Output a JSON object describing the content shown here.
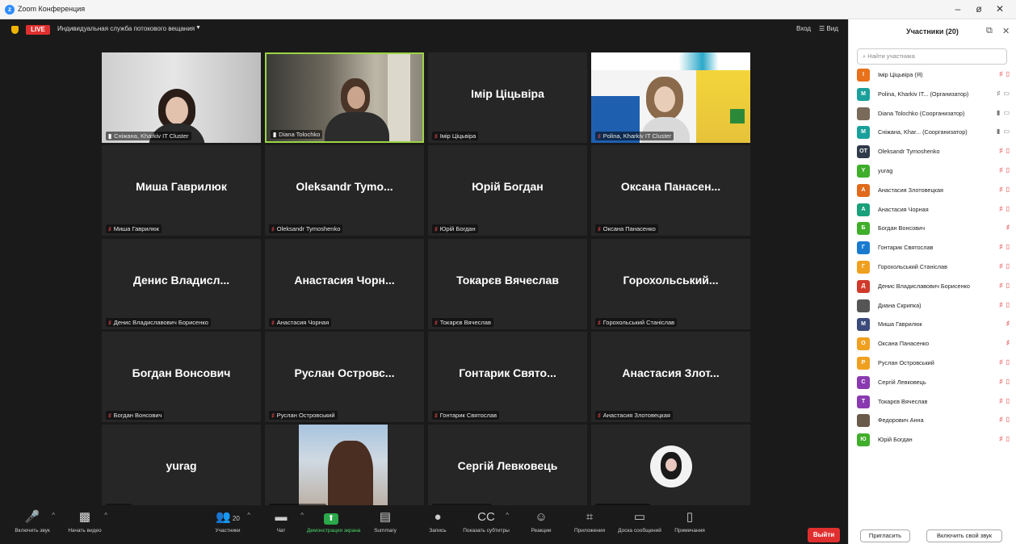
{
  "window": {
    "title": "Zoom Конференция"
  },
  "topbar": {
    "live": "LIVE",
    "stream": "Индивидуальная служба потокового вещания",
    "view_in": "Вход",
    "view_grid": "Вид"
  },
  "tiles": [
    {
      "name": "",
      "label": "Сніжана, Kharkiv IT Cluster",
      "video": "sn"
    },
    {
      "name": "",
      "label": "Diana Tolochko",
      "video": "dt",
      "active": true
    },
    {
      "name": "Імір Ціцьвіра",
      "label": "Імір Ціцьвіра"
    },
    {
      "name": "",
      "label": "Polina, Kharkiv IT Cluster",
      "video": "pl"
    },
    {
      "name": "Миша Гаврилюк",
      "label": "Миша Гаврилюк"
    },
    {
      "name": "Oleksandr Tymo...",
      "label": "Oleksandr Tymoshenko"
    },
    {
      "name": "Юрій Богдан",
      "label": "Юрій Богдан"
    },
    {
      "name": "Оксана Панасен...",
      "label": "Оксана Панасенко"
    },
    {
      "name": "Денис Владисл...",
      "label": "Денис Владиславович Борисенко"
    },
    {
      "name": "Анастасия Чорн...",
      "label": "Анастасия Чорная"
    },
    {
      "name": "Токарєв Вячеслав",
      "label": "Токарєв Вячеслав"
    },
    {
      "name": "Горохольський...",
      "label": "Горохольський Станіслав"
    },
    {
      "name": "Богдан Вонсович",
      "label": "Богдан Вонсович"
    },
    {
      "name": "Руслан Островс...",
      "label": "Руслан Островський"
    },
    {
      "name": "Гонтарик Свято...",
      "label": "Гонтарик Святослав"
    },
    {
      "name": "Анастасия Злот...",
      "label": "Анастасия Злотовецкая"
    },
    {
      "name": "yurag",
      "label": "yurag"
    },
    {
      "name": "",
      "label": "Федорович Анна",
      "video": "fa"
    },
    {
      "name": "Сергій Левковець",
      "label": "Сергій Левковець"
    },
    {
      "name": "",
      "label": "Диана Скрипка)",
      "video": "ds"
    }
  ],
  "toolbar": [
    {
      "label": "Включить звук",
      "icon": "mic-off-icon"
    },
    {
      "label": "Начать видео",
      "icon": "video-off-icon"
    },
    {
      "label": "Участники",
      "icon": "participants-icon",
      "count": "20"
    },
    {
      "label": "Чат",
      "icon": "chat-icon"
    },
    {
      "label": "Демонстрация экрана",
      "icon": "share-screen-icon"
    },
    {
      "label": "Summary",
      "icon": "summary-icon"
    },
    {
      "label": "Запись",
      "icon": "record-icon"
    },
    {
      "label": "Показать субтитры",
      "icon": "captions-icon"
    },
    {
      "label": "Реакции",
      "icon": "reactions-icon"
    },
    {
      "label": "Приложения",
      "icon": "apps-icon"
    },
    {
      "label": "Доска сообщений",
      "icon": "whiteboard-icon"
    },
    {
      "label": "Примечания",
      "icon": "notes-icon"
    }
  ],
  "leave_label": "Выйти",
  "panel": {
    "title": "Участники (20)",
    "search_placeholder": "Найти участника",
    "participants": [
      {
        "initial": "І",
        "name": "Імір Ціцьвіра (Я)",
        "color": "#e8711a"
      },
      {
        "initial": "M",
        "name": "Polina, Kharkiv IT... (Организатор)",
        "color": "#1aa09a"
      },
      {
        "initial": "",
        "name": "Diana Tolochko (Соорганизатор)",
        "color": "#7a6a5a"
      },
      {
        "initial": "M",
        "name": "Сніжана, Khar... (Соорганизатор)",
        "color": "#1aa09a"
      },
      {
        "initial": "OT",
        "name": "Oleksandr Tymoshenko",
        "color": "#2f3a4a"
      },
      {
        "initial": "Y",
        "name": "yurag",
        "color": "#3fae2a"
      },
      {
        "initial": "А",
        "name": "Анастасия Злотовецкая",
        "color": "#e06a1a"
      },
      {
        "initial": "А",
        "name": "Анастасия Чорная",
        "color": "#1aa07a"
      },
      {
        "initial": "Б",
        "name": "Богдан Вонсович",
        "color": "#3fae2a"
      },
      {
        "initial": "Г",
        "name": "Гонтарик Святослав",
        "color": "#1a7ad0"
      },
      {
        "initial": "Г",
        "name": "Горохольський Станіслав",
        "color": "#f0a020"
      },
      {
        "initial": "Д",
        "name": "Денис Владиславович Борисенко",
        "color": "#d03a2a"
      },
      {
        "initial": "",
        "name": "Диана Скрипка)",
        "color": "#555555"
      },
      {
        "initial": "М",
        "name": "Миша Гаврилюк",
        "color": "#3a4a7a"
      },
      {
        "initial": "О",
        "name": "Оксана Панасенко",
        "color": "#f0a020"
      },
      {
        "initial": "Р",
        "name": "Руслан Островський",
        "color": "#f0a020"
      },
      {
        "initial": "С",
        "name": "Сергій Левковець",
        "color": "#8a3ab0"
      },
      {
        "initial": "Т",
        "name": "Токарєв Вячеслав",
        "color": "#8a3ab0"
      },
      {
        "initial": "",
        "name": "Федорович Анна",
        "color": "#6a5a4a"
      },
      {
        "initial": "Ю",
        "name": "Юрій Богдан",
        "color": "#3fae2a"
      }
    ],
    "invite": "Пригласить",
    "unmute": "Включить свой звук"
  }
}
